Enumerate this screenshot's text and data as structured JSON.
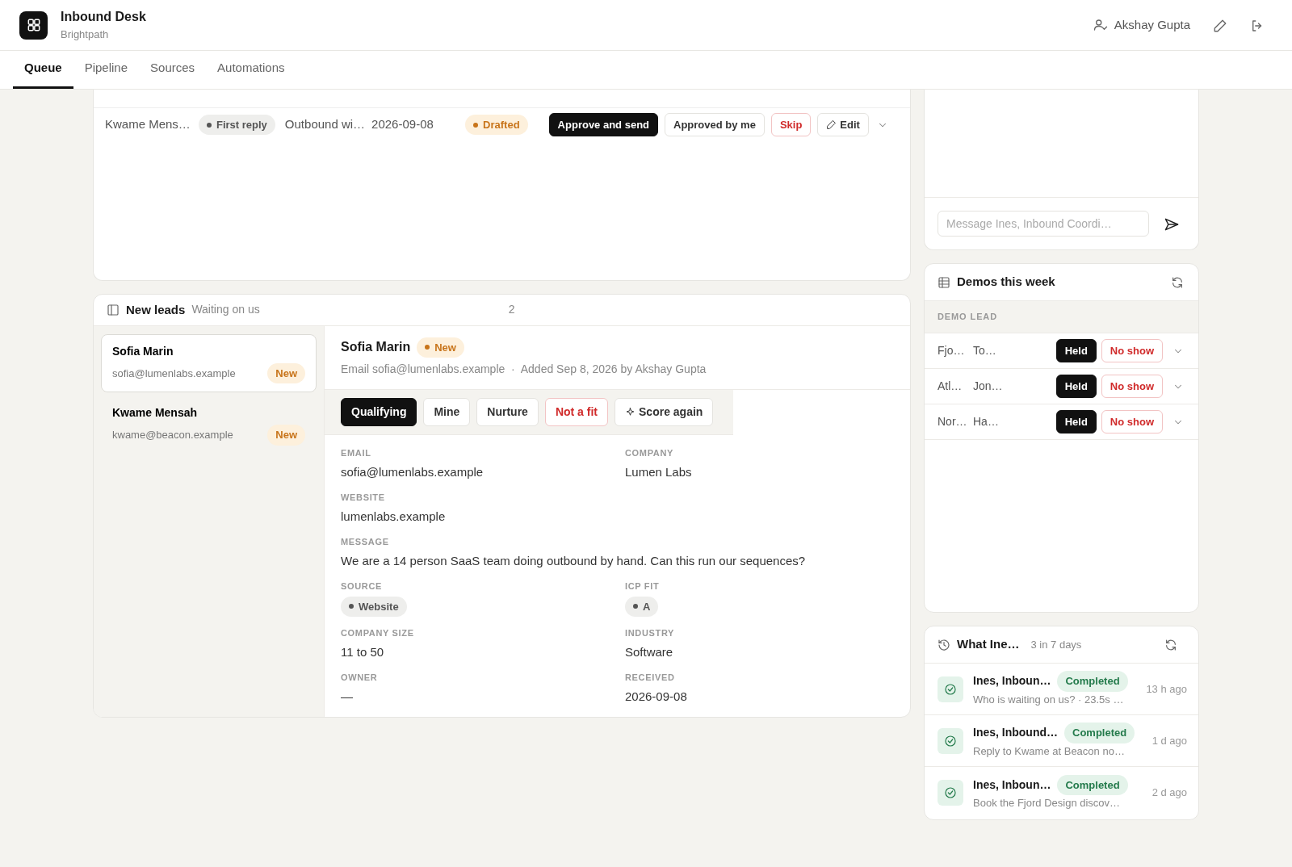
{
  "app": {
    "title": "Inbound Desk",
    "subtitle": "Brightpath"
  },
  "user": {
    "name": "Akshay Gupta"
  },
  "tabs": [
    {
      "label": "Queue",
      "selected": true
    },
    {
      "label": "Pipeline",
      "selected": false
    },
    {
      "label": "Sources",
      "selected": false
    },
    {
      "label": "Automations",
      "selected": false
    }
  ],
  "queue": {
    "rows": [
      {
        "name": "Kwame Mens…",
        "tag": "First reply",
        "subject": "Outbound wi…",
        "date": "2026-09-08",
        "status": "Drafted",
        "buttons": [
          "Approve and send",
          "Approved by me",
          "Skip",
          "Edit"
        ]
      }
    ]
  },
  "chat": {
    "placeholder": "Message Ines, Inbound Coordi…"
  },
  "new_leads": {
    "title": "New leads",
    "subtitle": "Waiting on us",
    "count": "2",
    "list": [
      {
        "name": "Sofia Marin",
        "email": "sofia@lumenlabs.example",
        "badge": "New",
        "selected": true
      },
      {
        "name": "Kwame Mensah",
        "email": "kwame@beacon.example",
        "badge": "New",
        "selected": false
      }
    ],
    "detail": {
      "name": "Sofia Marin",
      "badge": "New",
      "meta": "Email sofia@lumenlabs.example  ·  Added Sep 8, 2026 by Akshay Gupta",
      "actions": [
        {
          "label": "Qualifying",
          "kind": "primary"
        },
        {
          "label": "Mine",
          "kind": "plain"
        },
        {
          "label": "Nurture",
          "kind": "plain"
        },
        {
          "label": "Not a fit",
          "kind": "danger"
        },
        {
          "label": "Score again",
          "kind": "sparkle"
        }
      ],
      "fields": [
        {
          "label": "EMAIL",
          "value": "sofia@lumenlabs.example",
          "kind": "text"
        },
        {
          "label": "COMPANY",
          "value": "Lumen Labs",
          "kind": "text"
        },
        {
          "label": "WEBSITE",
          "value": "lumenlabs.example",
          "kind": "text"
        },
        {
          "label": "MESSAGE",
          "value": "We are a 14 person SaaS team doing outbound by hand. Can this run our sequences?",
          "kind": "long"
        },
        {
          "label": "SOURCE",
          "value": "Website",
          "kind": "tag"
        },
        {
          "label": "ICP FIT",
          "value": "A",
          "kind": "tag"
        },
        {
          "label": "COMPANY SIZE",
          "value": "11 to 50",
          "kind": "text"
        },
        {
          "label": "INDUSTRY",
          "value": "Software",
          "kind": "text"
        },
        {
          "label": "OWNER",
          "value": "—",
          "kind": "text"
        },
        {
          "label": "RECEIVED",
          "value": "2026-09-08",
          "kind": "text"
        }
      ]
    }
  },
  "demos": {
    "title": "Demos this week",
    "columns": [
      "DEMO",
      "LEAD"
    ],
    "rows": [
      {
        "demo": "Fjo…",
        "lead": "To…",
        "buttons": [
          "Held",
          "No show"
        ]
      },
      {
        "demo": "Atl…",
        "lead": "Jon…",
        "buttons": [
          "Held",
          "No show"
        ]
      },
      {
        "demo": "Nor…",
        "lead": "Ha…",
        "buttons": [
          "Held",
          "No show"
        ]
      }
    ]
  },
  "activity": {
    "title": "What Ine…",
    "subtitle": "3 in 7 days",
    "items": [
      {
        "title": "Ines, Inboun…",
        "status": "Completed",
        "detail": "Who is waiting on us? · 23.5s …",
        "time": "13 h ago"
      },
      {
        "title": "Ines, Inbound…",
        "status": "Completed",
        "detail": "Reply to Kwame at Beacon no…",
        "time": "1 d ago"
      },
      {
        "title": "Ines, Inboun…",
        "status": "Completed",
        "detail": "Book the Fjord Design discov…",
        "time": "2 d ago"
      }
    ]
  }
}
